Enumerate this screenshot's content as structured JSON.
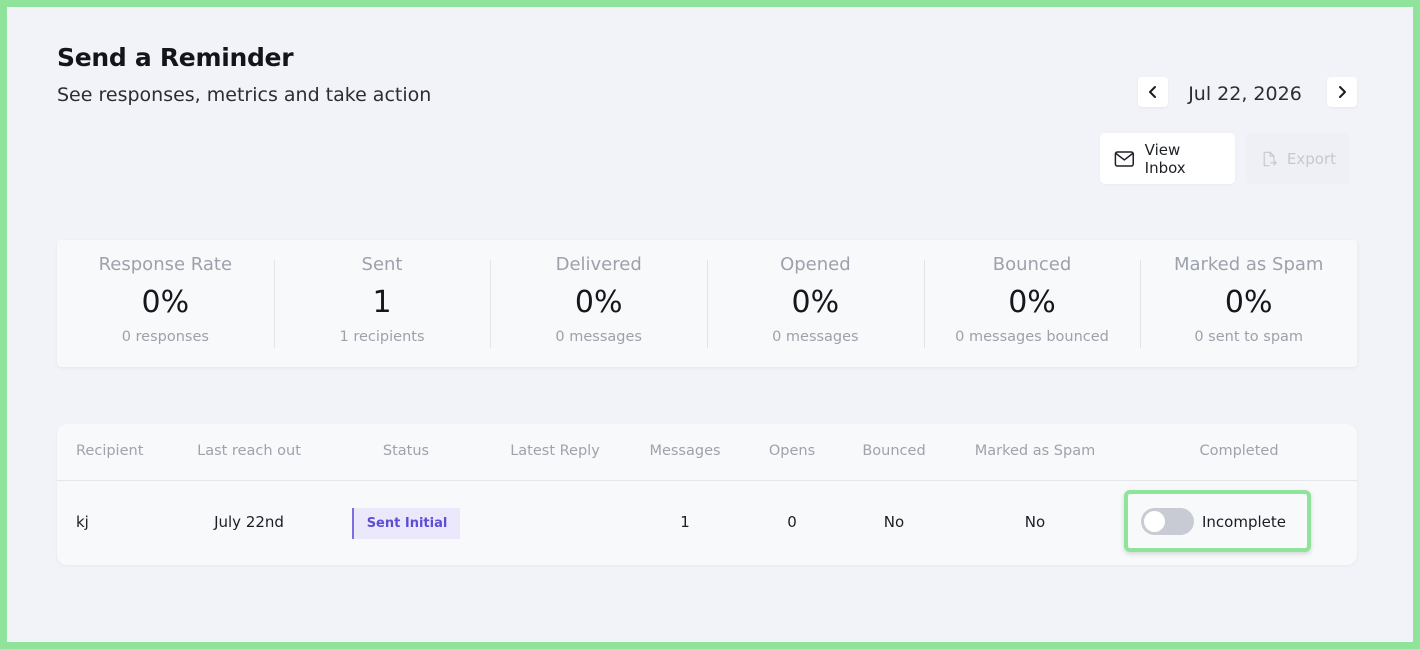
{
  "header": {
    "title": "Send a Reminder",
    "subtitle": "See responses, metrics and take action"
  },
  "date_nav": {
    "prev_icon": "chevron-left-icon",
    "date": "Jul 22, 2026",
    "next_icon": "chevron-right-icon"
  },
  "actions": {
    "view_inbox": "View Inbox",
    "export": "Export"
  },
  "stats": [
    {
      "label": "Response Rate",
      "value": "0%",
      "sub": "0 responses"
    },
    {
      "label": "Sent",
      "value": "1",
      "sub": "1 recipients"
    },
    {
      "label": "Delivered",
      "value": "0%",
      "sub": "0 messages"
    },
    {
      "label": "Opened",
      "value": "0%",
      "sub": "0 messages"
    },
    {
      "label": "Bounced",
      "value": "0%",
      "sub": "0 messages bounced"
    },
    {
      "label": "Marked as Spam",
      "value": "0%",
      "sub": "0 sent to spam"
    }
  ],
  "table": {
    "columns": [
      "Recipient",
      "Last reach out",
      "Status",
      "Latest Reply",
      "Messages",
      "Opens",
      "Bounced",
      "Marked as Spam",
      "Completed"
    ],
    "rows": [
      {
        "recipient": "kj",
        "last_reach_out": "July 22nd",
        "status": "Sent Initial",
        "latest_reply": "",
        "messages": "1",
        "opens": "0",
        "bounced": "No",
        "marked_as_spam": "No",
        "completed": "Incomplete"
      }
    ]
  },
  "colors": {
    "highlight_border": "#8fe39a",
    "status_accent": "#7b6ee0",
    "status_text": "#5d4fd4"
  }
}
